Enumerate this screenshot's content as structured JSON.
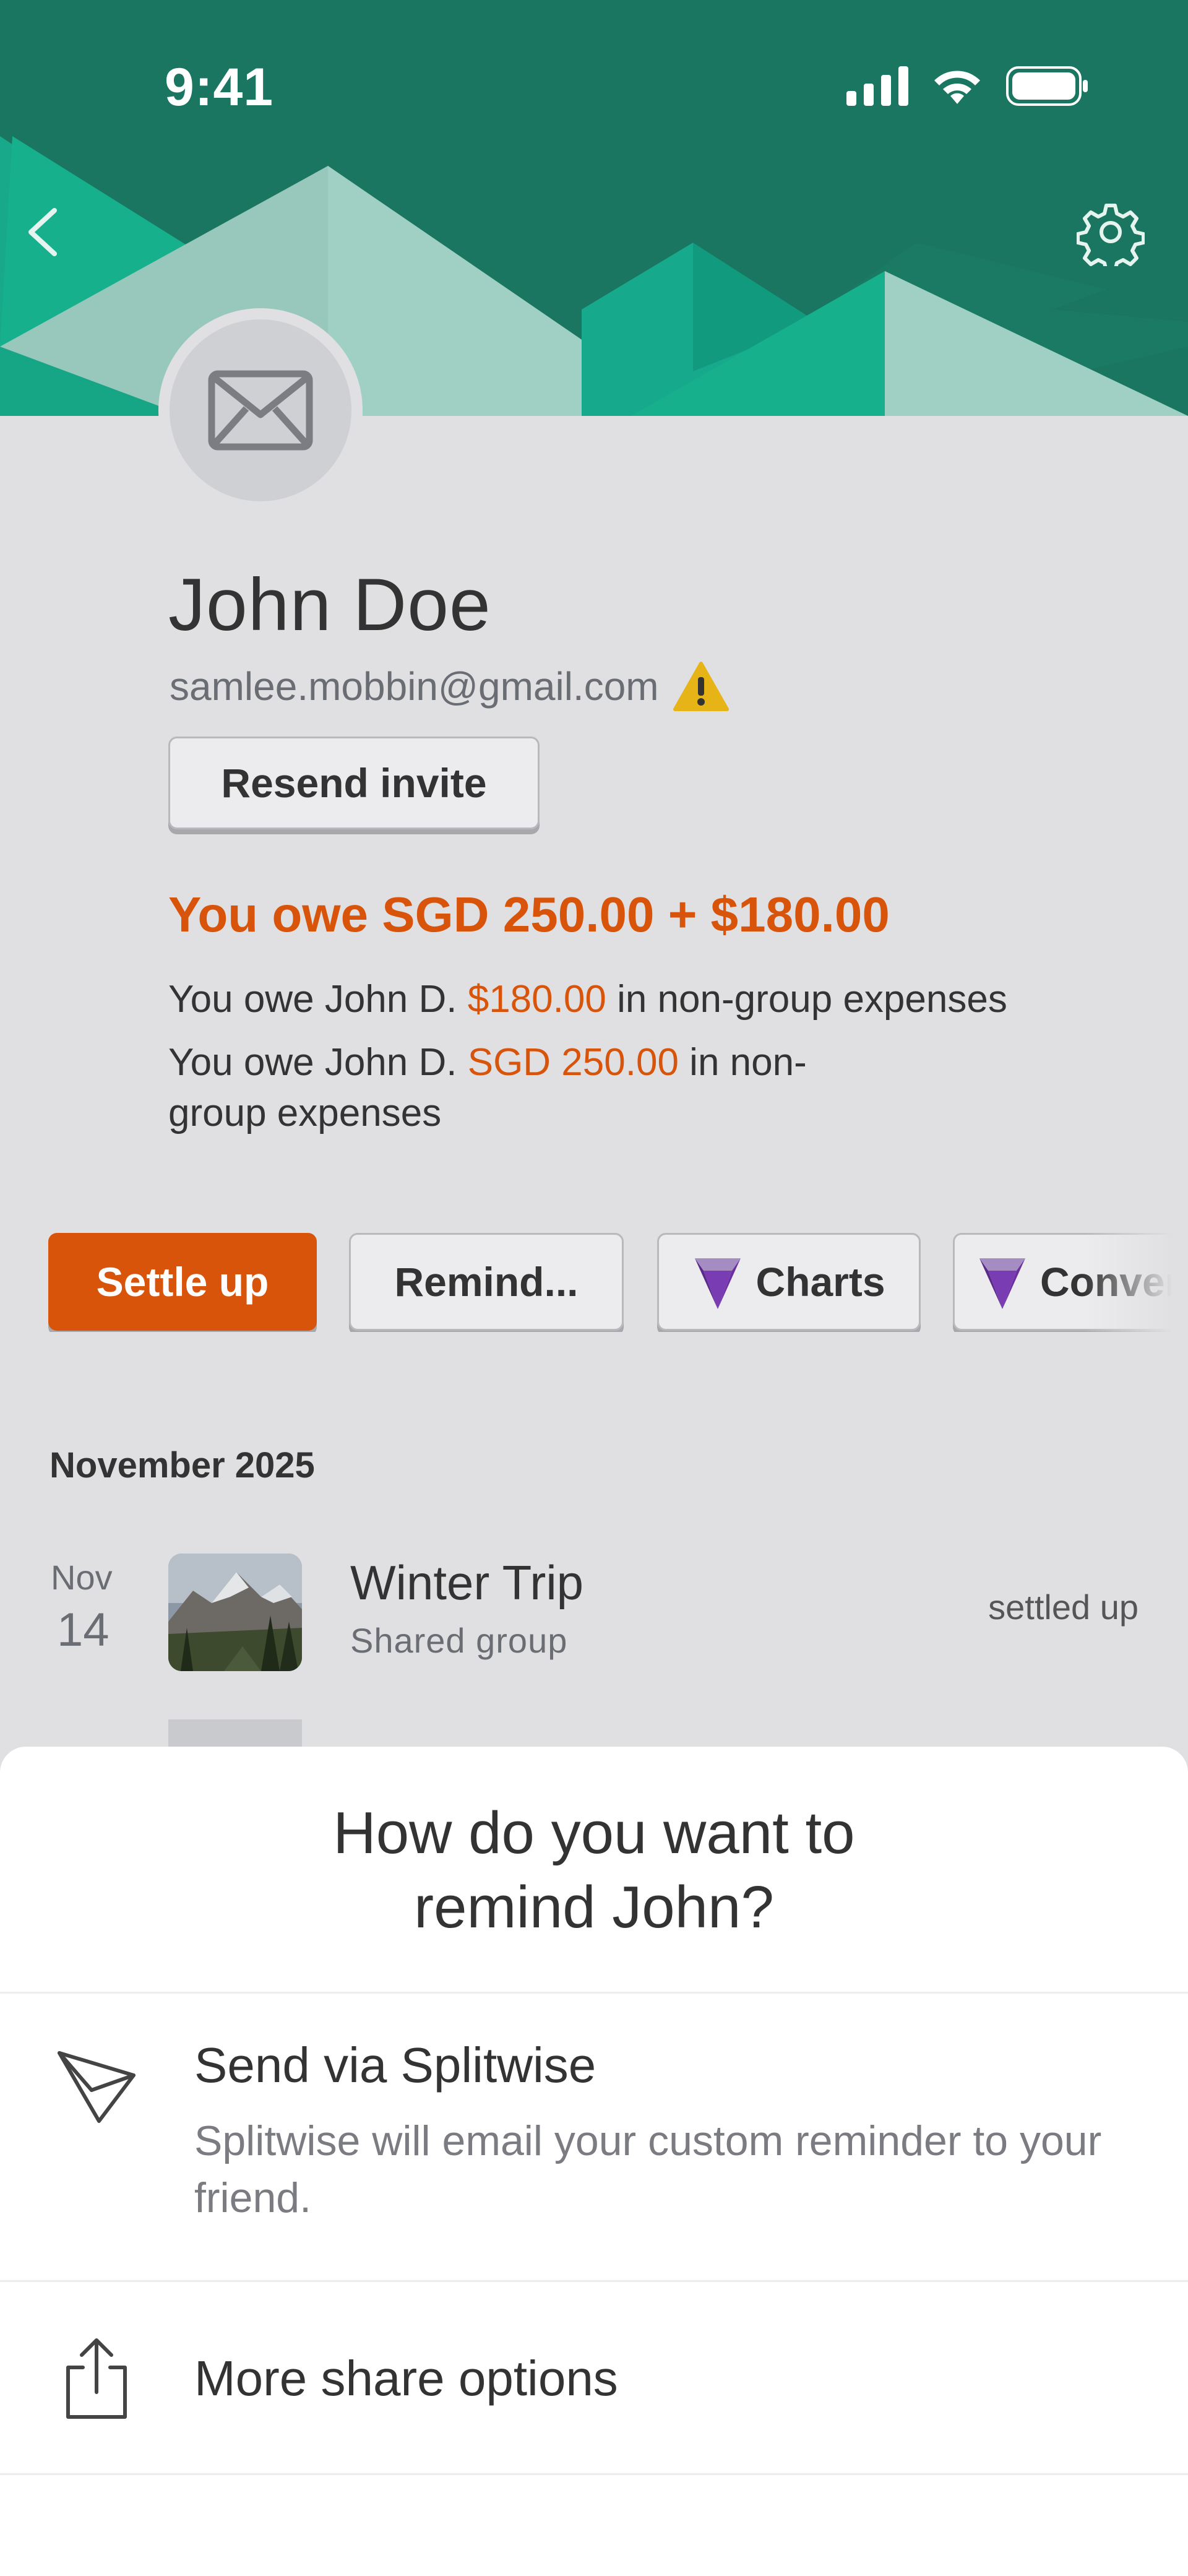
{
  "status_bar": {
    "time": "9:41"
  },
  "profile": {
    "name": "John Doe",
    "email": "samlee.mobbin@gmail.com",
    "resend_label": "Resend invite"
  },
  "balance": {
    "headline": "You owe SGD 250.00 + $180.00",
    "line1_prefix": "You owe John D. ",
    "line1_amount": "$180.00",
    "line1_suffix": " in non-group expenses",
    "line2_prefix": "You owe John D. ",
    "line2_amount": "SGD 250.00",
    "line2_suffix": " in non-",
    "line2_cont": "group expenses"
  },
  "actions": {
    "settle": "Settle up",
    "remind": "Remind...",
    "charts": "Charts",
    "convert": "Conver"
  },
  "activity": {
    "month_header": "November 2025",
    "items": [
      {
        "month": "Nov",
        "day": "14",
        "title": "Winter Trip",
        "subtitle": "Shared group",
        "status": "settled up"
      }
    ]
  },
  "sheet": {
    "title_line1": "How do you want to",
    "title_line2": "remind John?",
    "options": [
      {
        "icon": "send-icon",
        "title": "Send via Splitwise",
        "desc": "Splitwise will email your custom reminder to your friend."
      },
      {
        "icon": "share-icon",
        "title": "More share options"
      }
    ]
  },
  "colors": {
    "accent_orange": "#d9540b",
    "header_green": "#1a7660",
    "premium_purple": "#6b2fa0"
  }
}
